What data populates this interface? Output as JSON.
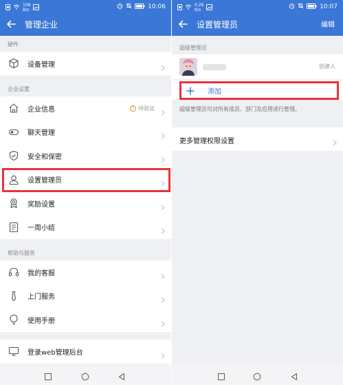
{
  "left": {
    "status": {
      "net_speed": "108",
      "net_unit": "B/s",
      "time": "10:06"
    },
    "title": "管理企业",
    "sections": [
      {
        "label": "硬件",
        "items": [
          {
            "label": "设备管理",
            "icon": "device-box-icon"
          }
        ]
      },
      {
        "label": "企业设置",
        "items": [
          {
            "label": "企业信息",
            "icon": "home-icon",
            "badge": "待验证"
          },
          {
            "label": "聊天管理",
            "icon": "chat-toggle-icon"
          },
          {
            "label": "安全和保密",
            "icon": "shield-icon"
          },
          {
            "label": "设置管理员",
            "icon": "user-icon"
          },
          {
            "label": "奖励设置",
            "icon": "award-icon"
          },
          {
            "label": "一周小结",
            "icon": "document-icon"
          }
        ]
      },
      {
        "label": "帮助与服务",
        "items": [
          {
            "label": "我的客服",
            "icon": "headset-icon"
          },
          {
            "label": "上门服务",
            "icon": "tie-icon"
          },
          {
            "label": "使用手册",
            "icon": "lightbulb-icon"
          }
        ]
      },
      {
        "label": "",
        "items": [
          {
            "label": "登录web管理后台",
            "icon": "monitor-icon"
          }
        ]
      }
    ]
  },
  "right": {
    "status": {
      "net_speed": "0.26",
      "net_unit": "K/s",
      "time": "10:07"
    },
    "title": "设置管理员",
    "edit_label": "编辑",
    "super_admin_label": "超级管理员",
    "creator_label": "创建人",
    "add_label": "添加",
    "description": "超级管理员可对所有成员、部门及应用进行管理。",
    "more_label": "更多管理权限设置"
  },
  "colors": {
    "header": "#3a77d6",
    "highlight": "#e8323c",
    "background": "#eef0f3"
  }
}
